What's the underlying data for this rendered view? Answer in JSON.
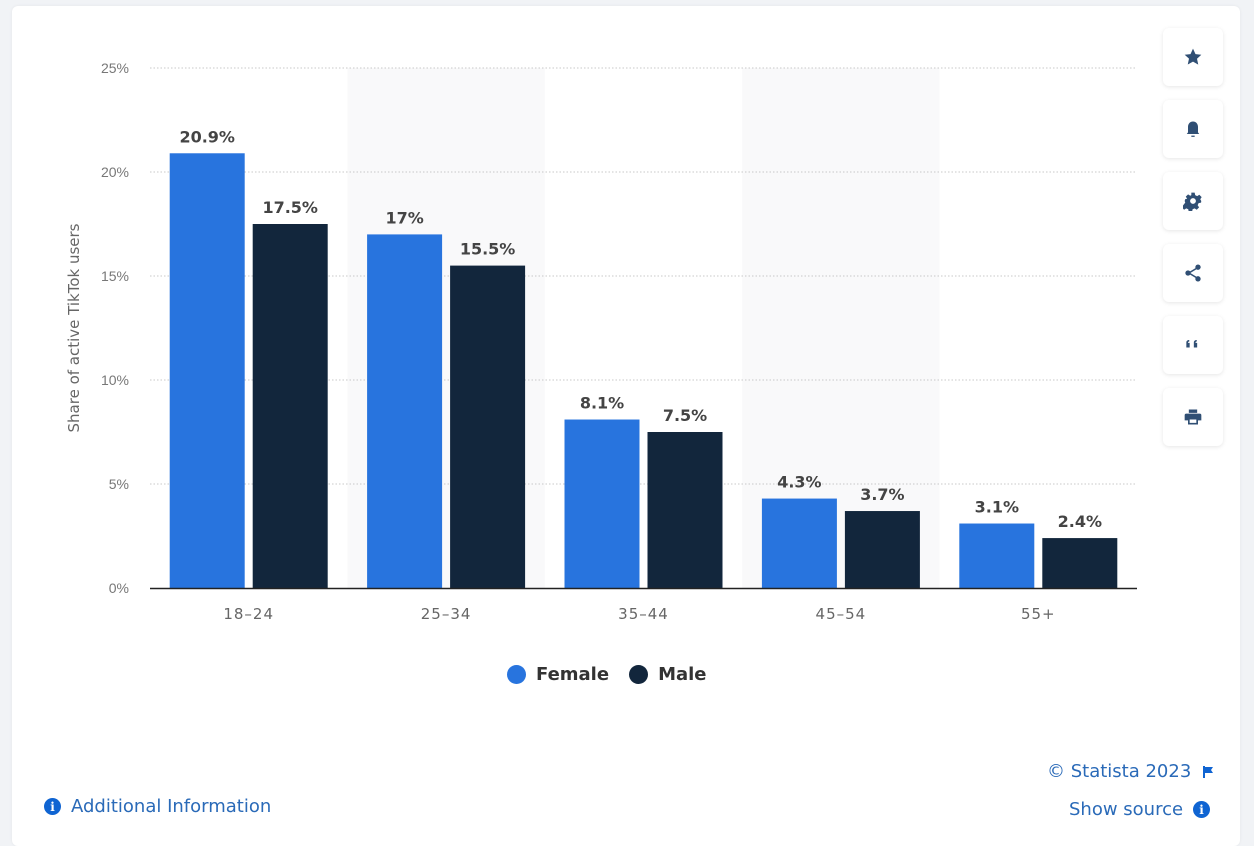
{
  "chart_data": {
    "type": "bar",
    "title": "",
    "xlabel": "",
    "ylabel": "Share of active TikTok users",
    "categories": [
      "18-24",
      "25-34",
      "35-44",
      "45-54",
      "55+"
    ],
    "series": [
      {
        "name": "Female",
        "color": "#2874de",
        "values": [
          20.9,
          17,
          8.1,
          4.3,
          3.1
        ],
        "labels": [
          "20.9%",
          "17%",
          "8.1%",
          "4.3%",
          "3.1%"
        ]
      },
      {
        "name": "Male",
        "color": "#12263c",
        "values": [
          17.5,
          15.5,
          7.5,
          3.7,
          2.4
        ],
        "labels": [
          "17.5%",
          "15.5%",
          "7.5%",
          "3.7%",
          "2.4%"
        ]
      }
    ],
    "ylim": [
      0,
      25
    ],
    "yticks": [
      0,
      5,
      10,
      15,
      20,
      25
    ],
    "ytick_labels": [
      "0%",
      "5%",
      "10%",
      "15%",
      "20%",
      "25%"
    ],
    "grid": true,
    "legend": "bottom-center"
  },
  "sidebar": [
    {
      "icon": "star-icon",
      "label": "Favorite"
    },
    {
      "icon": "bell-icon",
      "label": "Notifications"
    },
    {
      "icon": "gear-icon",
      "label": "Settings"
    },
    {
      "icon": "share-icon",
      "label": "Share"
    },
    {
      "icon": "quote-icon",
      "label": "Cite"
    },
    {
      "icon": "print-icon",
      "label": "Print"
    }
  ],
  "footer": {
    "additional_info": "Additional Information",
    "copyright": "© Statista 2023",
    "show_source": "Show source"
  }
}
